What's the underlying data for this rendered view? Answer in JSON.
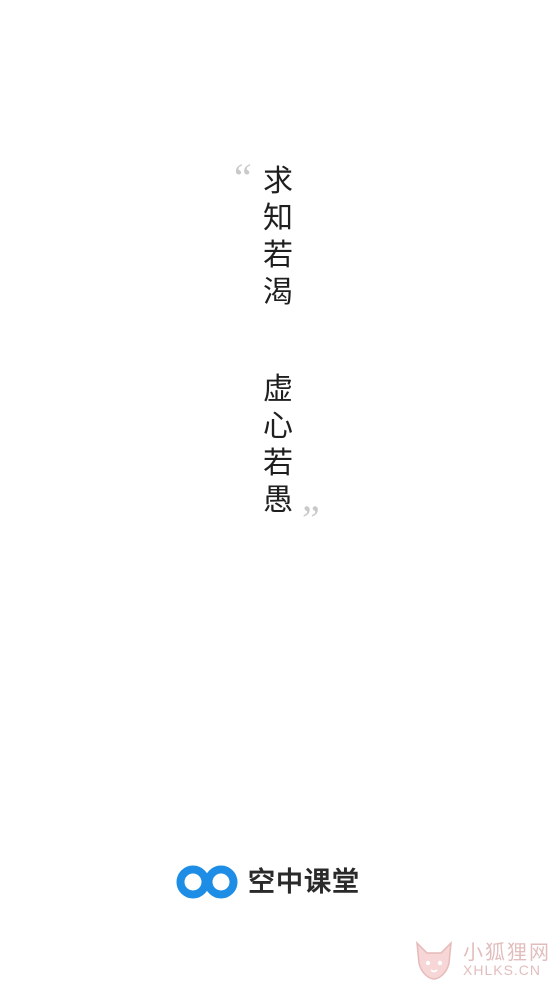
{
  "quote": {
    "open_mark": "“",
    "close_mark": "”",
    "line1": [
      "求",
      "知",
      "若",
      "渴"
    ],
    "line2": [
      "虚",
      "心",
      "若",
      "愚"
    ]
  },
  "brand": {
    "name": "空中课堂",
    "logo_icon": "infinity-loop-icon",
    "accent_color": "#1e8de6"
  },
  "watermark": {
    "title": "小狐狸网",
    "subtitle": "XHLKS.CN",
    "icon": "fox-icon",
    "color": "#e0a3a3"
  }
}
